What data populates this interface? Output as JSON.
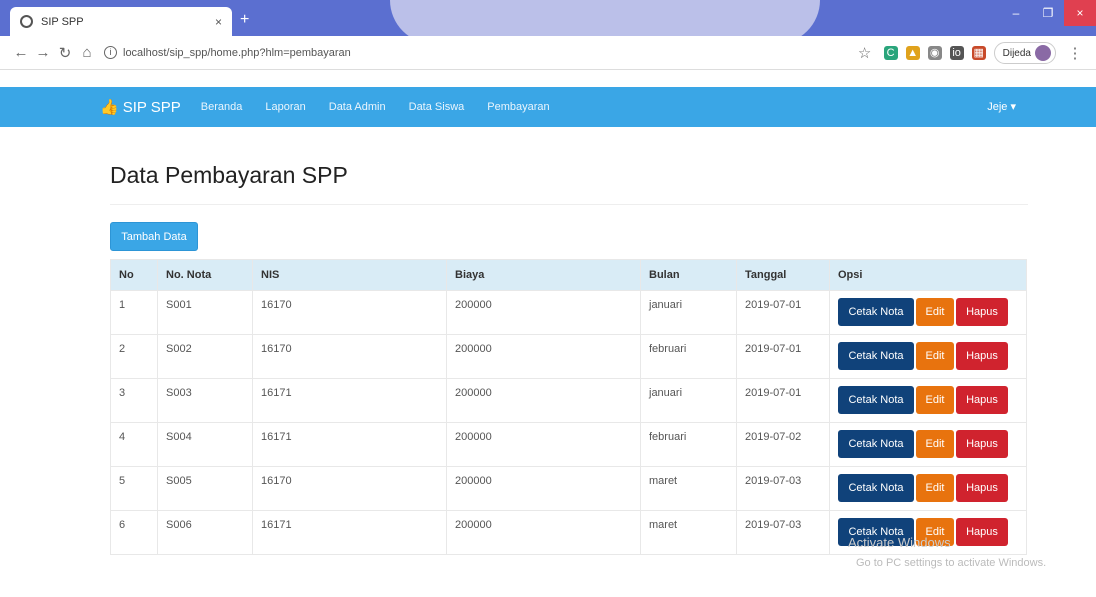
{
  "browser": {
    "tab_title": "SIP SPP",
    "tab_close": "×",
    "new_tab": "+",
    "url": "localhost/sip_spp/home.php?hlm=pembayaran",
    "profile_name": "Dijeda",
    "window_controls": [
      "–",
      "❐",
      "×"
    ]
  },
  "navbar": {
    "brand": "SIP SPP",
    "links": [
      "Beranda",
      "Laporan",
      "Data Admin",
      "Data Siswa",
      "Pembayaran"
    ],
    "user": "Jeje ▾"
  },
  "page": {
    "title": "Data Pembayaran SPP",
    "add_button": "Tambah Data"
  },
  "table": {
    "headers": [
      "No",
      "No. Nota",
      "NIS",
      "Biaya",
      "Bulan",
      "Tanggal",
      "Opsi"
    ],
    "rows": [
      [
        "1",
        "S001",
        "16170",
        "200000",
        "januari",
        "2019-07-01"
      ],
      [
        "2",
        "S002",
        "16170",
        "200000",
        "februari",
        "2019-07-01"
      ],
      [
        "3",
        "S003",
        "16171",
        "200000",
        "januari",
        "2019-07-01"
      ],
      [
        "4",
        "S004",
        "16171",
        "200000",
        "februari",
        "2019-07-02"
      ],
      [
        "5",
        "S005",
        "16170",
        "200000",
        "maret",
        "2019-07-03"
      ],
      [
        "6",
        "S006",
        "16171",
        "200000",
        "maret",
        "2019-07-03"
      ]
    ],
    "actions": {
      "print": "Cetak Nota",
      "edit": "Edit",
      "delete": "Hapus"
    }
  },
  "watermark": {
    "line1": "Activate Windows",
    "line2": "Go to PC settings to activate Windows."
  }
}
